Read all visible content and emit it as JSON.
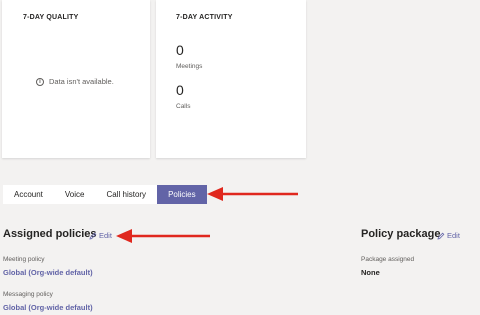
{
  "cards": {
    "quality": {
      "title": "7-DAY QUALITY",
      "empty_message": "Data isn't available."
    },
    "activity": {
      "title": "7-DAY ACTIVITY",
      "meetings_count": "0",
      "meetings_label": "Meetings",
      "calls_count": "0",
      "calls_label": "Calls"
    }
  },
  "tabs": [
    {
      "label": "Account",
      "active": false
    },
    {
      "label": "Voice",
      "active": false
    },
    {
      "label": "Call history",
      "active": false
    },
    {
      "label": "Policies",
      "active": true
    }
  ],
  "assigned_policies": {
    "title": "Assigned policies",
    "edit_label": "Edit",
    "meeting_policy_label": "Meeting policy",
    "meeting_policy_value": "Global (Org-wide default)",
    "messaging_policy_label": "Messaging policy",
    "messaging_policy_value": "Global (Org-wide default)"
  },
  "policy_package": {
    "title": "Policy package",
    "edit_label": "Edit",
    "package_label": "Package assigned",
    "package_value": "None"
  },
  "colors": {
    "accent": "#6264a7",
    "annotation_arrow": "#e0281e",
    "background": "#f3f2f1"
  },
  "icons": {
    "info": "info-circle-icon",
    "edit": "pencil-icon"
  }
}
